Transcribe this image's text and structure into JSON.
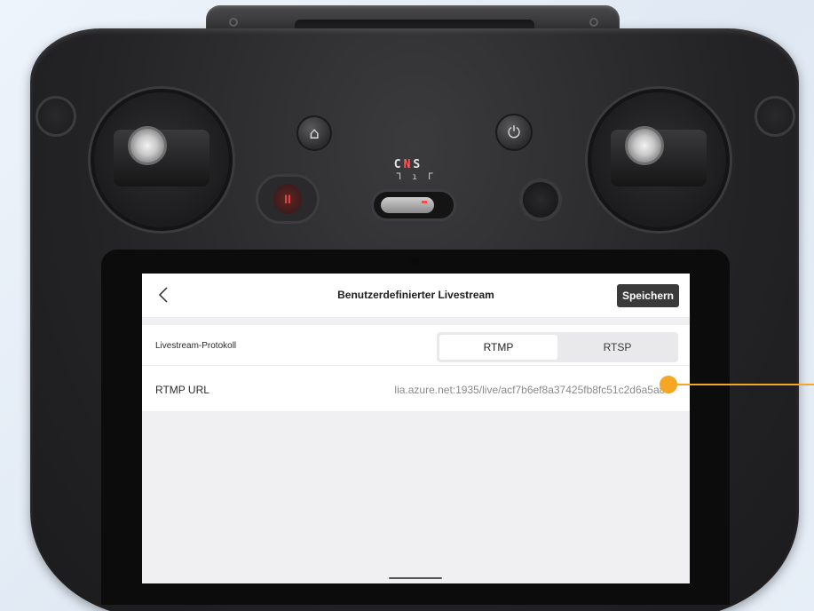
{
  "device": {
    "mode_switch_label": "C N S",
    "mode_ticks": "ᒣ ı ᒥ"
  },
  "screen": {
    "header": {
      "back_icon": "chevron-left-icon",
      "title": "Benutzerdefinierter Livestream",
      "save_label": "Speichern"
    },
    "protocol_row": {
      "label": "Livestream-Protokoll",
      "options": [
        "RTMP",
        "RTSP"
      ],
      "selected": "RTMP"
    },
    "url_row": {
      "label": "RTMP URL",
      "value": "lia.azure.net:1935/live/acf7b6ef8a37425fb8fc51c2d6a5a86"
    }
  },
  "callout": {
    "color": "#f5a623"
  }
}
